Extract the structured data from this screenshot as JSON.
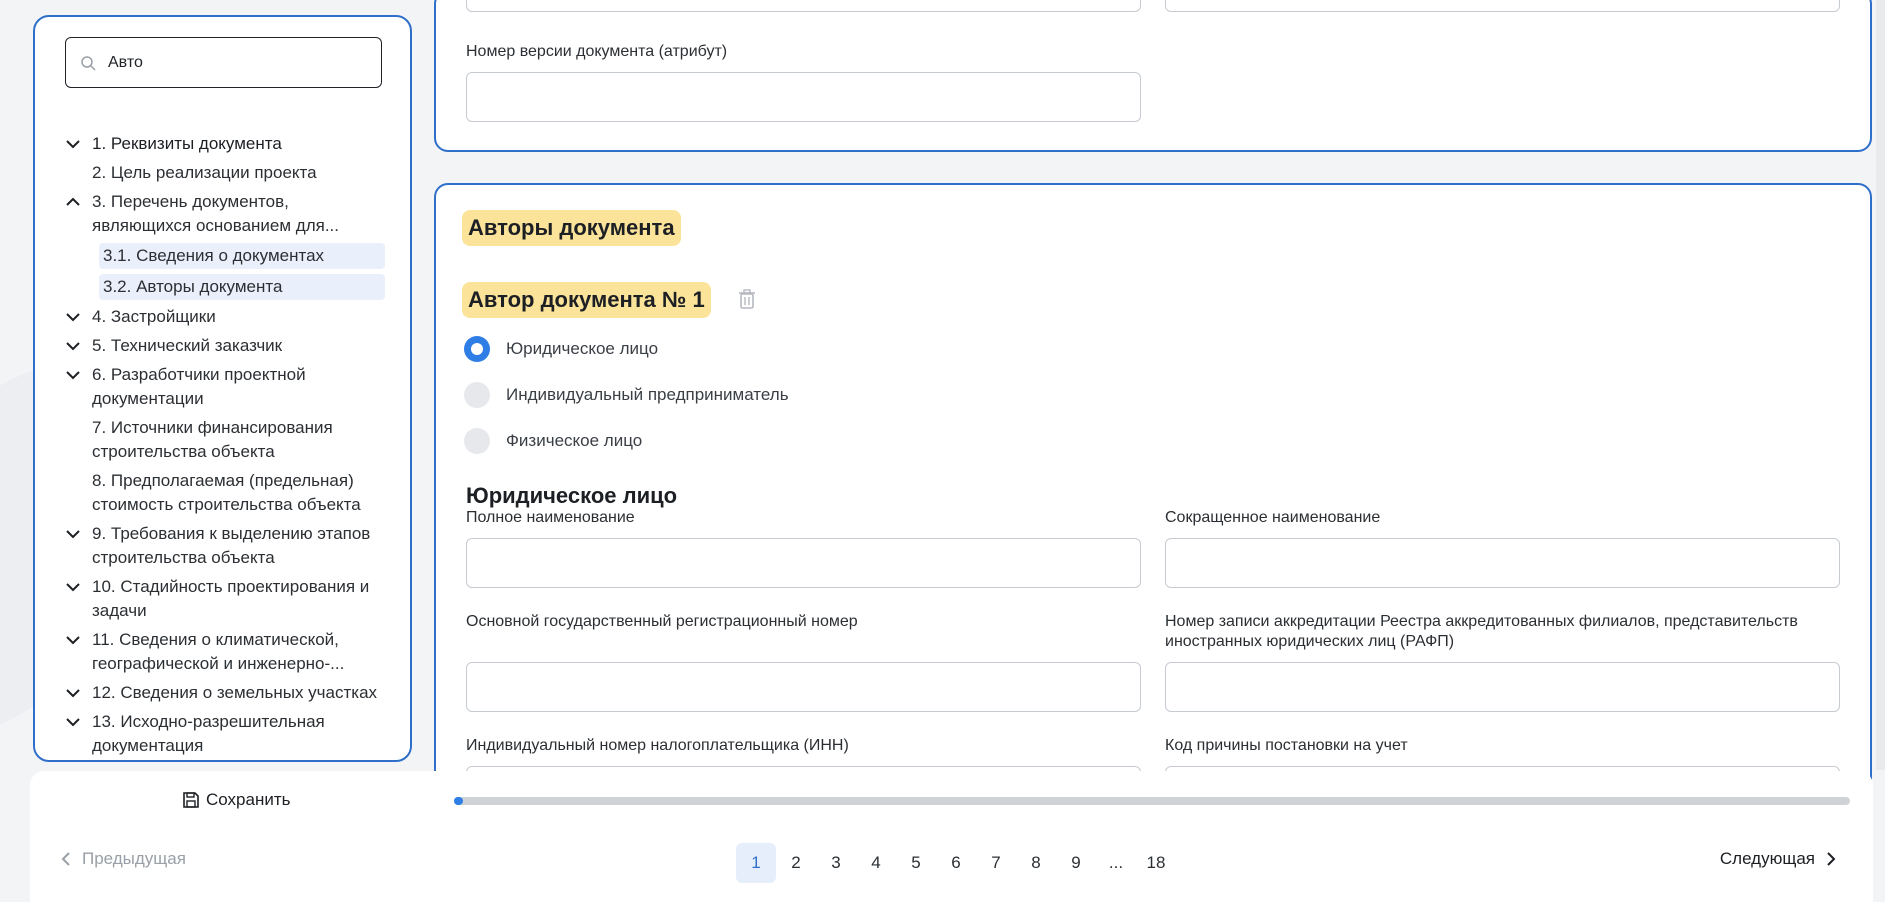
{
  "sidebar": {
    "search": {
      "value": "Авто"
    },
    "items": [
      {
        "label": "1. Реквизиты документа",
        "chevron": "down"
      },
      {
        "label": "2. Цель реализации проекта",
        "chevron": ""
      },
      {
        "label": "3. Перечень документов, являющихся основанием для...",
        "chevron": "up"
      },
      {
        "label": "4. Застройщики",
        "chevron": "down"
      },
      {
        "label": "5. Технический заказчик",
        "chevron": "down"
      },
      {
        "label": "6. Разработчики проектной документации",
        "chevron": "down"
      },
      {
        "label": "7. Источники финансирования строительства объекта",
        "chevron": ""
      },
      {
        "label": "8. Предполагаемая (предельная) стоимость строительства объекта",
        "chevron": ""
      },
      {
        "label": "9. Требования к выделению этапов строительства объекта",
        "chevron": "down"
      },
      {
        "label": "10. Стадийность проектирования и задачи",
        "chevron": "down"
      },
      {
        "label": "11. Сведения о климатической, географической и инженерно-...",
        "chevron": "down"
      },
      {
        "label": "12. Сведения о земельных участках",
        "chevron": "down"
      },
      {
        "label": "13. Исходно-разрешительная документация",
        "chevron": "down"
      }
    ],
    "subitems": [
      {
        "label": "3.1. Сведения о документах"
      },
      {
        "label": "3.2. Авторы документа"
      }
    ]
  },
  "top_panel": {
    "version_label": "Номер версии документа (атрибут)"
  },
  "main": {
    "section_title": "Авторы документа",
    "author_title": "Автор документа № 1",
    "radios": [
      {
        "label": "Юридическое лицо",
        "selected": true
      },
      {
        "label": "Индивидуальный предприниматель",
        "selected": false
      },
      {
        "label": "Физическое лицо",
        "selected": false
      }
    ],
    "entity_heading": "Юридическое лицо",
    "fields": {
      "full_name": "Полное наименование",
      "short_name": "Сокращенное наименование",
      "ogrn": "Основной государственный регистрационный номер",
      "rafp": "Номер записи аккредитации Реестра аккредитованных филиалов, представительств иностранных юридических лиц (РАФП)",
      "inn": "Индивидуальный номер налогоплательщика (ИНН)",
      "kpp": "Код причины постановки на учет"
    }
  },
  "footer": {
    "save_label": "Сохранить",
    "progress_fraction": 0.005,
    "prev_label": "Предыдущая",
    "next_label": "Следующая",
    "pages": [
      "1",
      "2",
      "3",
      "4",
      "5",
      "6",
      "7",
      "8",
      "9",
      "...",
      "18"
    ],
    "current_page": "1"
  },
  "colors": {
    "accent": "#2f6fc9",
    "highlight": "#fbe39a",
    "progress": "#2f7ee6"
  },
  "icons": [
    "search-icon",
    "chevron-down-icon",
    "chevron-up-icon",
    "trash-icon",
    "save-icon",
    "chevron-left-icon",
    "chevron-right-icon"
  ]
}
